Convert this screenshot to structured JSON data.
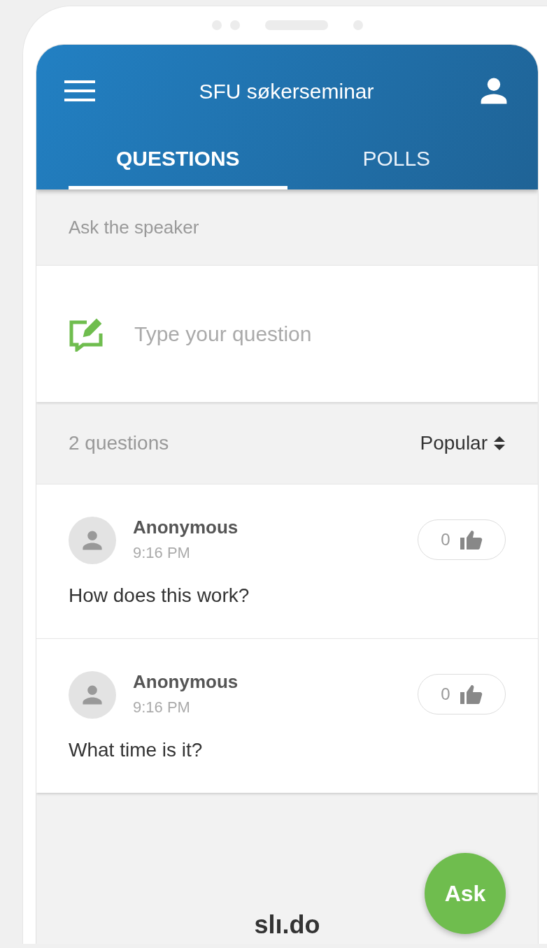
{
  "header": {
    "title": "SFU søkerseminar"
  },
  "tabs": [
    {
      "label": "QUESTIONS",
      "selected": true
    },
    {
      "label": "POLLS",
      "selected": false
    }
  ],
  "section_label": "Ask the speaker",
  "question_input": {
    "placeholder": "Type your question"
  },
  "list_header": {
    "count": "2 questions",
    "sort": "Popular"
  },
  "questions": [
    {
      "author": "Anonymous",
      "time": "9:16 PM",
      "text": "How does this work?",
      "votes": "0"
    },
    {
      "author": "Anonymous",
      "time": "9:16 PM",
      "text": "What time is it?",
      "votes": "0"
    }
  ],
  "ask_button": "Ask",
  "logo": "slı.do"
}
